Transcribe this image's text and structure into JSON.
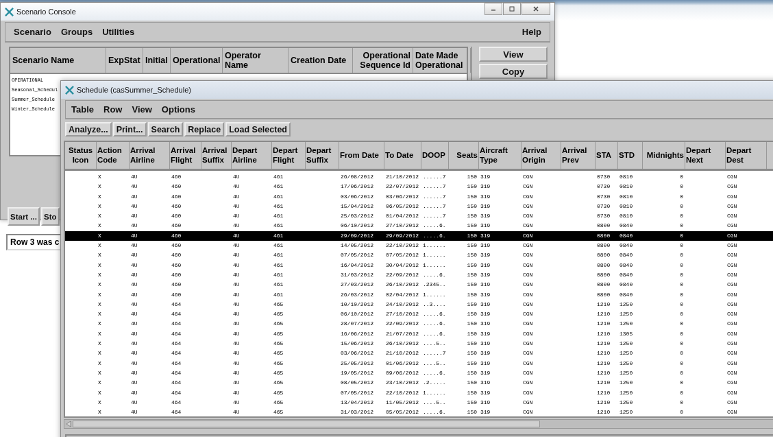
{
  "console": {
    "title": "Scenario Console",
    "menu": [
      "Scenario",
      "Groups",
      "Utilities"
    ],
    "help": "Help",
    "columns": [
      "Scenario Name",
      "ExpStat",
      "Initial",
      "Operational",
      "Operator Name",
      "Creation Date",
      "Operational Sequence Id",
      "Date Made Operational"
    ],
    "rows": [
      "OPERATIONAL",
      "Seasonal_Schedul",
      "Summer_Schedule",
      "Winter_Schedule"
    ],
    "side_buttons": [
      "View",
      "Copy"
    ],
    "bottom_buttons": [
      "Start ...",
      "Sto"
    ],
    "status": "Row 3 was c"
  },
  "schedule": {
    "title": "Schedule (casSummer_Schedule)",
    "menu": [
      "Table",
      "Row",
      "View",
      "Options"
    ],
    "toolbar": [
      "Analyze...",
      "Print...",
      "Search",
      "Replace",
      "Load Selected"
    ],
    "columns": [
      "Status Icon",
      "Action Code",
      "Arrival Airline",
      "Arrival Flight",
      "Arrival Suffix",
      "Depart Airline",
      "Depart Flight",
      "Depart Suffix",
      "From Date",
      "To Date",
      "DOOP",
      "Seats",
      "Aircraft Type",
      "Arrival Origin",
      "Arrival Prev",
      "STA",
      "STD",
      "Midnights",
      "Depart Next",
      "Depart Dest"
    ],
    "rows": [
      {
        "action": "X",
        "arr_airline": "4U",
        "arr_flight": "460",
        "dep_airline": "4U",
        "dep_flight": "461",
        "from": "26/08/2012",
        "to": "21/10/2012",
        "doop": "......7",
        "seats": "150",
        "type": "319",
        "origin": "CGN",
        "sta": "0730",
        "std": "0810",
        "midnights": "0",
        "dest": "CGN",
        "selected": false
      },
      {
        "action": "X",
        "arr_airline": "4U",
        "arr_flight": "460",
        "dep_airline": "4U",
        "dep_flight": "461",
        "from": "17/06/2012",
        "to": "22/07/2012",
        "doop": "......7",
        "seats": "150",
        "type": "319",
        "origin": "CGN",
        "sta": "0730",
        "std": "0810",
        "midnights": "0",
        "dest": "CGN",
        "selected": false
      },
      {
        "action": "X",
        "arr_airline": "4U",
        "arr_flight": "460",
        "dep_airline": "4U",
        "dep_flight": "461",
        "from": "03/06/2012",
        "to": "03/06/2012",
        "doop": "......7",
        "seats": "150",
        "type": "319",
        "origin": "CGN",
        "sta": "0730",
        "std": "0810",
        "midnights": "0",
        "dest": "CGN",
        "selected": false
      },
      {
        "action": "X",
        "arr_airline": "4U",
        "arr_flight": "460",
        "dep_airline": "4U",
        "dep_flight": "461",
        "from": "15/04/2012",
        "to": "06/05/2012",
        "doop": "......7",
        "seats": "150",
        "type": "319",
        "origin": "CGN",
        "sta": "0730",
        "std": "0810",
        "midnights": "0",
        "dest": "CGN",
        "selected": false
      },
      {
        "action": "X",
        "arr_airline": "4U",
        "arr_flight": "460",
        "dep_airline": "4U",
        "dep_flight": "461",
        "from": "25/03/2012",
        "to": "01/04/2012",
        "doop": "......7",
        "seats": "150",
        "type": "319",
        "origin": "CGN",
        "sta": "0730",
        "std": "0810",
        "midnights": "0",
        "dest": "CGN",
        "selected": false
      },
      {
        "action": "X",
        "arr_airline": "4U",
        "arr_flight": "460",
        "dep_airline": "4U",
        "dep_flight": "461",
        "from": "06/10/2012",
        "to": "27/10/2012",
        "doop": ".....6.",
        "seats": "150",
        "type": "319",
        "origin": "CGN",
        "sta": "0800",
        "std": "0840",
        "midnights": "0",
        "dest": "CGN",
        "selected": false
      },
      {
        "action": "X",
        "arr_airline": "4U",
        "arr_flight": "460",
        "dep_airline": "4U",
        "dep_flight": "461",
        "from": "29/09/2012",
        "to": "29/09/2012",
        "doop": ".....6.",
        "seats": "150",
        "type": "319",
        "origin": "CGN",
        "sta": "0800",
        "std": "0840",
        "midnights": "0",
        "dest": "CGN",
        "selected": true
      },
      {
        "action": "X",
        "arr_airline": "4U",
        "arr_flight": "460",
        "dep_airline": "4U",
        "dep_flight": "461",
        "from": "14/05/2012",
        "to": "22/10/2012",
        "doop": "1......",
        "seats": "150",
        "type": "319",
        "origin": "CGN",
        "sta": "0800",
        "std": "0840",
        "midnights": "0",
        "dest": "CGN",
        "selected": false
      },
      {
        "action": "X",
        "arr_airline": "4U",
        "arr_flight": "460",
        "dep_airline": "4U",
        "dep_flight": "461",
        "from": "07/05/2012",
        "to": "07/05/2012",
        "doop": "1......",
        "seats": "150",
        "type": "319",
        "origin": "CGN",
        "sta": "0800",
        "std": "0840",
        "midnights": "0",
        "dest": "CGN",
        "selected": false
      },
      {
        "action": "X",
        "arr_airline": "4U",
        "arr_flight": "460",
        "dep_airline": "4U",
        "dep_flight": "461",
        "from": "16/04/2012",
        "to": "30/04/2012",
        "doop": "1......",
        "seats": "150",
        "type": "319",
        "origin": "CGN",
        "sta": "0800",
        "std": "0840",
        "midnights": "0",
        "dest": "CGN",
        "selected": false
      },
      {
        "action": "X",
        "arr_airline": "4U",
        "arr_flight": "460",
        "dep_airline": "4U",
        "dep_flight": "461",
        "from": "31/03/2012",
        "to": "22/09/2012",
        "doop": ".....6.",
        "seats": "150",
        "type": "319",
        "origin": "CGN",
        "sta": "0800",
        "std": "0840",
        "midnights": "0",
        "dest": "CGN",
        "selected": false
      },
      {
        "action": "X",
        "arr_airline": "4U",
        "arr_flight": "460",
        "dep_airline": "4U",
        "dep_flight": "461",
        "from": "27/03/2012",
        "to": "26/10/2012",
        "doop": ".2345..",
        "seats": "150",
        "type": "319",
        "origin": "CGN",
        "sta": "0800",
        "std": "0840",
        "midnights": "0",
        "dest": "CGN",
        "selected": false
      },
      {
        "action": "X",
        "arr_airline": "4U",
        "arr_flight": "460",
        "dep_airline": "4U",
        "dep_flight": "461",
        "from": "26/03/2012",
        "to": "02/04/2012",
        "doop": "1......",
        "seats": "150",
        "type": "319",
        "origin": "CGN",
        "sta": "0800",
        "std": "0840",
        "midnights": "0",
        "dest": "CGN",
        "selected": false
      },
      {
        "action": "X",
        "arr_airline": "4U",
        "arr_flight": "464",
        "dep_airline": "4U",
        "dep_flight": "465",
        "from": "10/10/2012",
        "to": "24/10/2012",
        "doop": "..3....",
        "seats": "150",
        "type": "319",
        "origin": "CGN",
        "sta": "1210",
        "std": "1250",
        "midnights": "0",
        "dest": "CGN",
        "selected": false
      },
      {
        "action": "X",
        "arr_airline": "4U",
        "arr_flight": "464",
        "dep_airline": "4U",
        "dep_flight": "465",
        "from": "06/10/2012",
        "to": "27/10/2012",
        "doop": ".....6.",
        "seats": "150",
        "type": "319",
        "origin": "CGN",
        "sta": "1210",
        "std": "1250",
        "midnights": "0",
        "dest": "CGN",
        "selected": false
      },
      {
        "action": "X",
        "arr_airline": "4U",
        "arr_flight": "464",
        "dep_airline": "4U",
        "dep_flight": "465",
        "from": "28/07/2012",
        "to": "22/09/2012",
        "doop": ".....6.",
        "seats": "150",
        "type": "319",
        "origin": "CGN",
        "sta": "1210",
        "std": "1250",
        "midnights": "0",
        "dest": "CGN",
        "selected": false
      },
      {
        "action": "X",
        "arr_airline": "4U",
        "arr_flight": "464",
        "dep_airline": "4U",
        "dep_flight": "465",
        "from": "16/06/2012",
        "to": "21/07/2012",
        "doop": ".....6.",
        "seats": "150",
        "type": "319",
        "origin": "CGN",
        "sta": "1210",
        "std": "1305",
        "midnights": "0",
        "dest": "CGN",
        "selected": false
      },
      {
        "action": "X",
        "arr_airline": "4U",
        "arr_flight": "464",
        "dep_airline": "4U",
        "dep_flight": "465",
        "from": "15/06/2012",
        "to": "26/10/2012",
        "doop": "....5..",
        "seats": "150",
        "type": "319",
        "origin": "CGN",
        "sta": "1210",
        "std": "1250",
        "midnights": "0",
        "dest": "CGN",
        "selected": false
      },
      {
        "action": "X",
        "arr_airline": "4U",
        "arr_flight": "464",
        "dep_airline": "4U",
        "dep_flight": "465",
        "from": "03/06/2012",
        "to": "21/10/2012",
        "doop": "......7",
        "seats": "150",
        "type": "319",
        "origin": "CGN",
        "sta": "1210",
        "std": "1250",
        "midnights": "0",
        "dest": "CGN",
        "selected": false
      },
      {
        "action": "X",
        "arr_airline": "4U",
        "arr_flight": "464",
        "dep_airline": "4U",
        "dep_flight": "465",
        "from": "25/05/2012",
        "to": "01/06/2012",
        "doop": "....5..",
        "seats": "150",
        "type": "319",
        "origin": "CGN",
        "sta": "1210",
        "std": "1250",
        "midnights": "0",
        "dest": "CGN",
        "selected": false
      },
      {
        "action": "X",
        "arr_airline": "4U",
        "arr_flight": "464",
        "dep_airline": "4U",
        "dep_flight": "465",
        "from": "19/05/2012",
        "to": "09/06/2012",
        "doop": ".....6.",
        "seats": "150",
        "type": "319",
        "origin": "CGN",
        "sta": "1210",
        "std": "1250",
        "midnights": "0",
        "dest": "CGN",
        "selected": false
      },
      {
        "action": "X",
        "arr_airline": "4U",
        "arr_flight": "464",
        "dep_airline": "4U",
        "dep_flight": "465",
        "from": "08/05/2012",
        "to": "23/10/2012",
        "doop": ".2.....",
        "seats": "150",
        "type": "319",
        "origin": "CGN",
        "sta": "1210",
        "std": "1250",
        "midnights": "0",
        "dest": "CGN",
        "selected": false
      },
      {
        "action": "X",
        "arr_airline": "4U",
        "arr_flight": "464",
        "dep_airline": "4U",
        "dep_flight": "465",
        "from": "07/05/2012",
        "to": "22/10/2012",
        "doop": "1......",
        "seats": "150",
        "type": "319",
        "origin": "CGN",
        "sta": "1210",
        "std": "1250",
        "midnights": "0",
        "dest": "CGN",
        "selected": false
      },
      {
        "action": "X",
        "arr_airline": "4U",
        "arr_flight": "464",
        "dep_airline": "4U",
        "dep_flight": "465",
        "from": "13/04/2012",
        "to": "11/05/2012",
        "doop": "....5..",
        "seats": "150",
        "type": "319",
        "origin": "CGN",
        "sta": "1210",
        "std": "1250",
        "midnights": "0",
        "dest": "CGN",
        "selected": false
      },
      {
        "action": "X",
        "arr_airline": "4U",
        "arr_flight": "464",
        "dep_airline": "4U",
        "dep_flight": "465",
        "from": "31/03/2012",
        "to": "05/05/2012",
        "doop": ".....6.",
        "seats": "150",
        "type": "319",
        "origin": "CGN",
        "sta": "1210",
        "std": "1250",
        "midnights": "0",
        "dest": "CGN",
        "selected": false
      }
    ]
  }
}
